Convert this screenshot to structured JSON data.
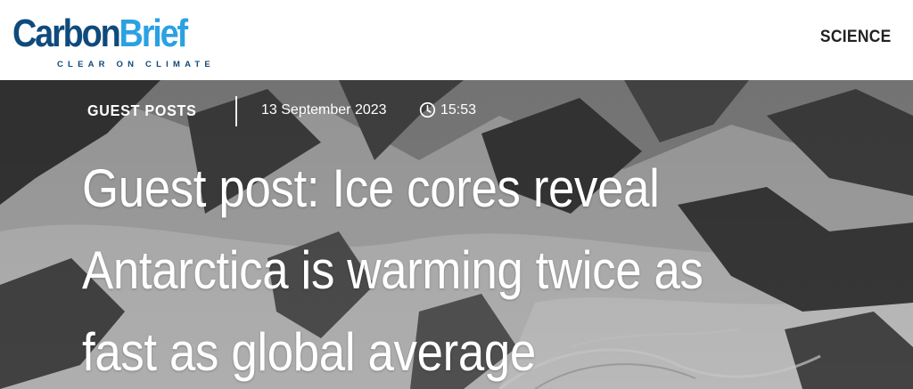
{
  "header": {
    "logo": {
      "carbon": "Carbon",
      "brief": "Brief",
      "tagline": "CLEAR ON CLIMATE",
      "colors": {
        "carbon": "#0f4a7c",
        "brief": "#2aa1e2"
      }
    },
    "nav": {
      "science_label": "SCIENCE"
    }
  },
  "article": {
    "category": "GUEST POSTS",
    "date": "13 September 2023",
    "time_icon": "clock-icon",
    "time": "15:53",
    "title_lines": [
      "Guest post: Ice cores reveal",
      "Antarctica is warming twice as",
      "fast as global average"
    ],
    "hero_image": "snow-covered mountains and glacier"
  }
}
